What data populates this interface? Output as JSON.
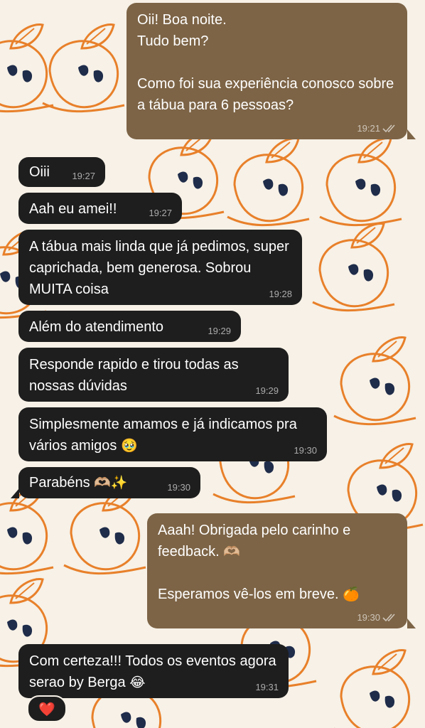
{
  "theme": {
    "incoming_bubble": "#1e1e1e",
    "outgoing_bubble": "#7d6446",
    "wallpaper_bg": "#f7f1e7",
    "wallpaper_orange": "#e8802a",
    "wallpaper_dark": "#1f2c4a"
  },
  "messages": [
    {
      "direction": "outgoing",
      "text": "Oii! Boa noite.\nTudo bem?\n\nComo foi sua experiência conosco sobre a tábua para 6 pessoas?",
      "time": "19:21",
      "status": "read"
    },
    {
      "direction": "incoming",
      "text": "Oiii",
      "time": "19:27"
    },
    {
      "direction": "incoming",
      "text": "Aah eu amei!!",
      "time": "19:27"
    },
    {
      "direction": "incoming",
      "text": "A tábua mais linda que já pedimos, super caprichada, bem generosa. Sobrou MUITA coisa",
      "time": "19:28"
    },
    {
      "direction": "incoming",
      "text": "Além do atendimento",
      "time": "19:29"
    },
    {
      "direction": "incoming",
      "text": "Responde rapido e tirou todas as nossas dúvidas",
      "time": "19:29"
    },
    {
      "direction": "incoming",
      "text": "Simplesmente amamos e já indicamos pra vários amigos",
      "emoji": "🥹",
      "time": "19:30"
    },
    {
      "direction": "incoming",
      "text": "Parabéns",
      "emoji": "🫶🏼✨",
      "time": "19:30"
    },
    {
      "direction": "outgoing",
      "text": "Aaah! Obrigada pelo carinho e feedback.",
      "emoji": "🫶🏼",
      "text2": "Esperamos vê-los em breve.",
      "emoji2": "🍊",
      "time": "19:30",
      "status": "read"
    },
    {
      "direction": "incoming",
      "text": "Com certeza!!! Todos os eventos agora serao by Berga",
      "emoji": "😂",
      "time": "19:31",
      "reaction": "❤️"
    }
  ]
}
